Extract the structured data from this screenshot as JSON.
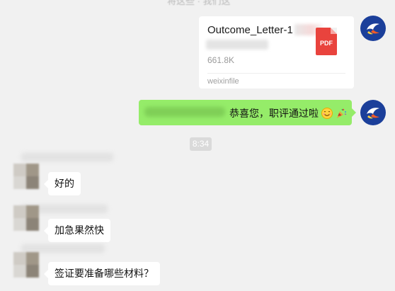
{
  "top_partial_text": "将这些 · 我们这",
  "file_message": {
    "file_name": "Outcome_Letter-1",
    "file_size": "661.8K",
    "source": "weixinfile",
    "icon_label": "PDF"
  },
  "sent_message": {
    "text": "恭喜您，职评通过啦",
    "emojis": [
      "smile-emoji",
      "party-popper-emoji"
    ]
  },
  "timestamp": "8:34",
  "incoming_messages": [
    {
      "text": "好的"
    },
    {
      "text": "加急果然快"
    },
    {
      "text": "签证要准备哪些材料？"
    }
  ],
  "colors": {
    "background": "#f1f1f1",
    "sent_bubble": "#95ec69",
    "received_bubble": "#ffffff",
    "pdf_red": "#e9433d",
    "time_badge": "#dadada"
  }
}
